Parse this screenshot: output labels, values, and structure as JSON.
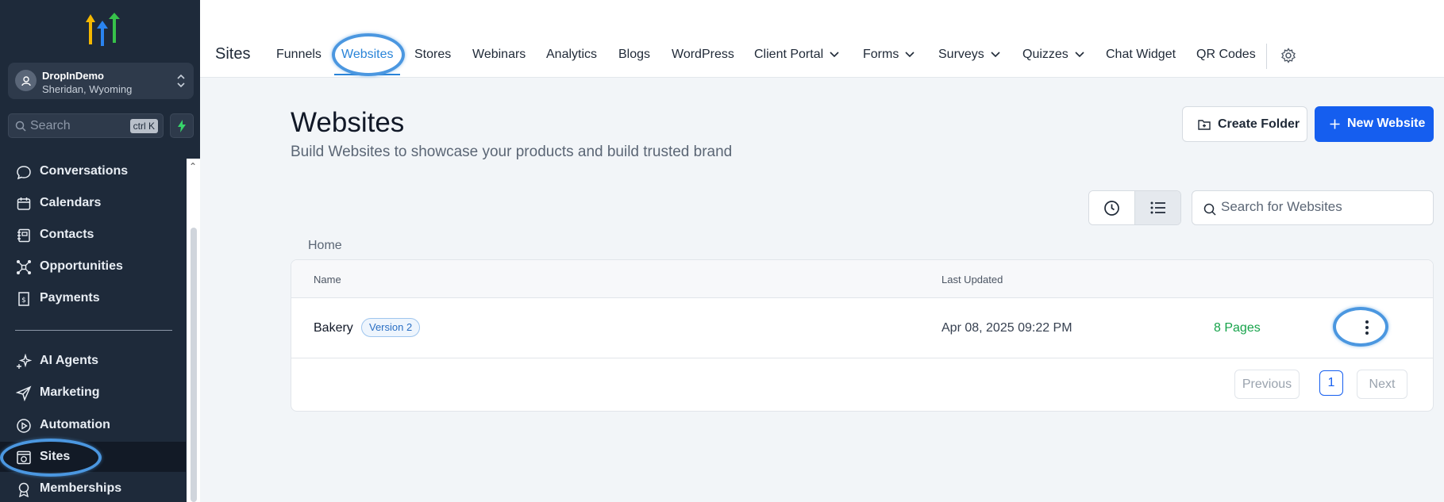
{
  "sidebar": {
    "account": {
      "name": "DropInDemo",
      "location": "Sheridan, Wyoming"
    },
    "search": {
      "placeholder": "Search",
      "shortcut": "ctrl K"
    },
    "items": [
      {
        "label": "Conversations",
        "icon": "chat-bubble-icon"
      },
      {
        "label": "Calendars",
        "icon": "calendar-icon"
      },
      {
        "label": "Contacts",
        "icon": "contact-book-icon"
      },
      {
        "label": "Opportunities",
        "icon": "network-icon"
      },
      {
        "label": "Payments",
        "icon": "receipt-icon"
      },
      {
        "label": "AI Agents",
        "icon": "sparkle-icon"
      },
      {
        "label": "Marketing",
        "icon": "send-icon"
      },
      {
        "label": "Automation",
        "icon": "play-icon"
      },
      {
        "label": "Sites",
        "icon": "globe-window-icon"
      },
      {
        "label": "Memberships",
        "icon": "award-icon"
      }
    ]
  },
  "topbar": {
    "title": "Sites",
    "tabs": [
      {
        "label": "Funnels"
      },
      {
        "label": "Websites"
      },
      {
        "label": "Stores"
      },
      {
        "label": "Webinars"
      },
      {
        "label": "Analytics"
      },
      {
        "label": "Blogs"
      },
      {
        "label": "WordPress"
      },
      {
        "label": "Client Portal"
      },
      {
        "label": "Forms"
      },
      {
        "label": "Surveys"
      },
      {
        "label": "Quizzes"
      },
      {
        "label": "Chat Widget"
      },
      {
        "label": "QR Codes"
      }
    ]
  },
  "page": {
    "title": "Websites",
    "subtitle": "Build Websites to showcase your products and build trusted brand",
    "create_folder": "Create Folder",
    "new_website": "New Website",
    "search_placeholder": "Search for Websites",
    "breadcrumb": "Home"
  },
  "table": {
    "headers": {
      "name": "Name",
      "updated": "Last Updated"
    },
    "rows": [
      {
        "name": "Bakery",
        "version": "Version 2",
        "updated": "Apr 08, 2025 09:22 PM",
        "pages": "8 Pages"
      }
    ]
  },
  "pagination": {
    "previous": "Previous",
    "current": "1",
    "next": "Next"
  },
  "colors": {
    "sidebar": "#1e2a3a",
    "accent": "#155eef",
    "tab_active": "#2a84d8",
    "success": "#16a34a",
    "highlight_ring": "#4b97e0"
  }
}
